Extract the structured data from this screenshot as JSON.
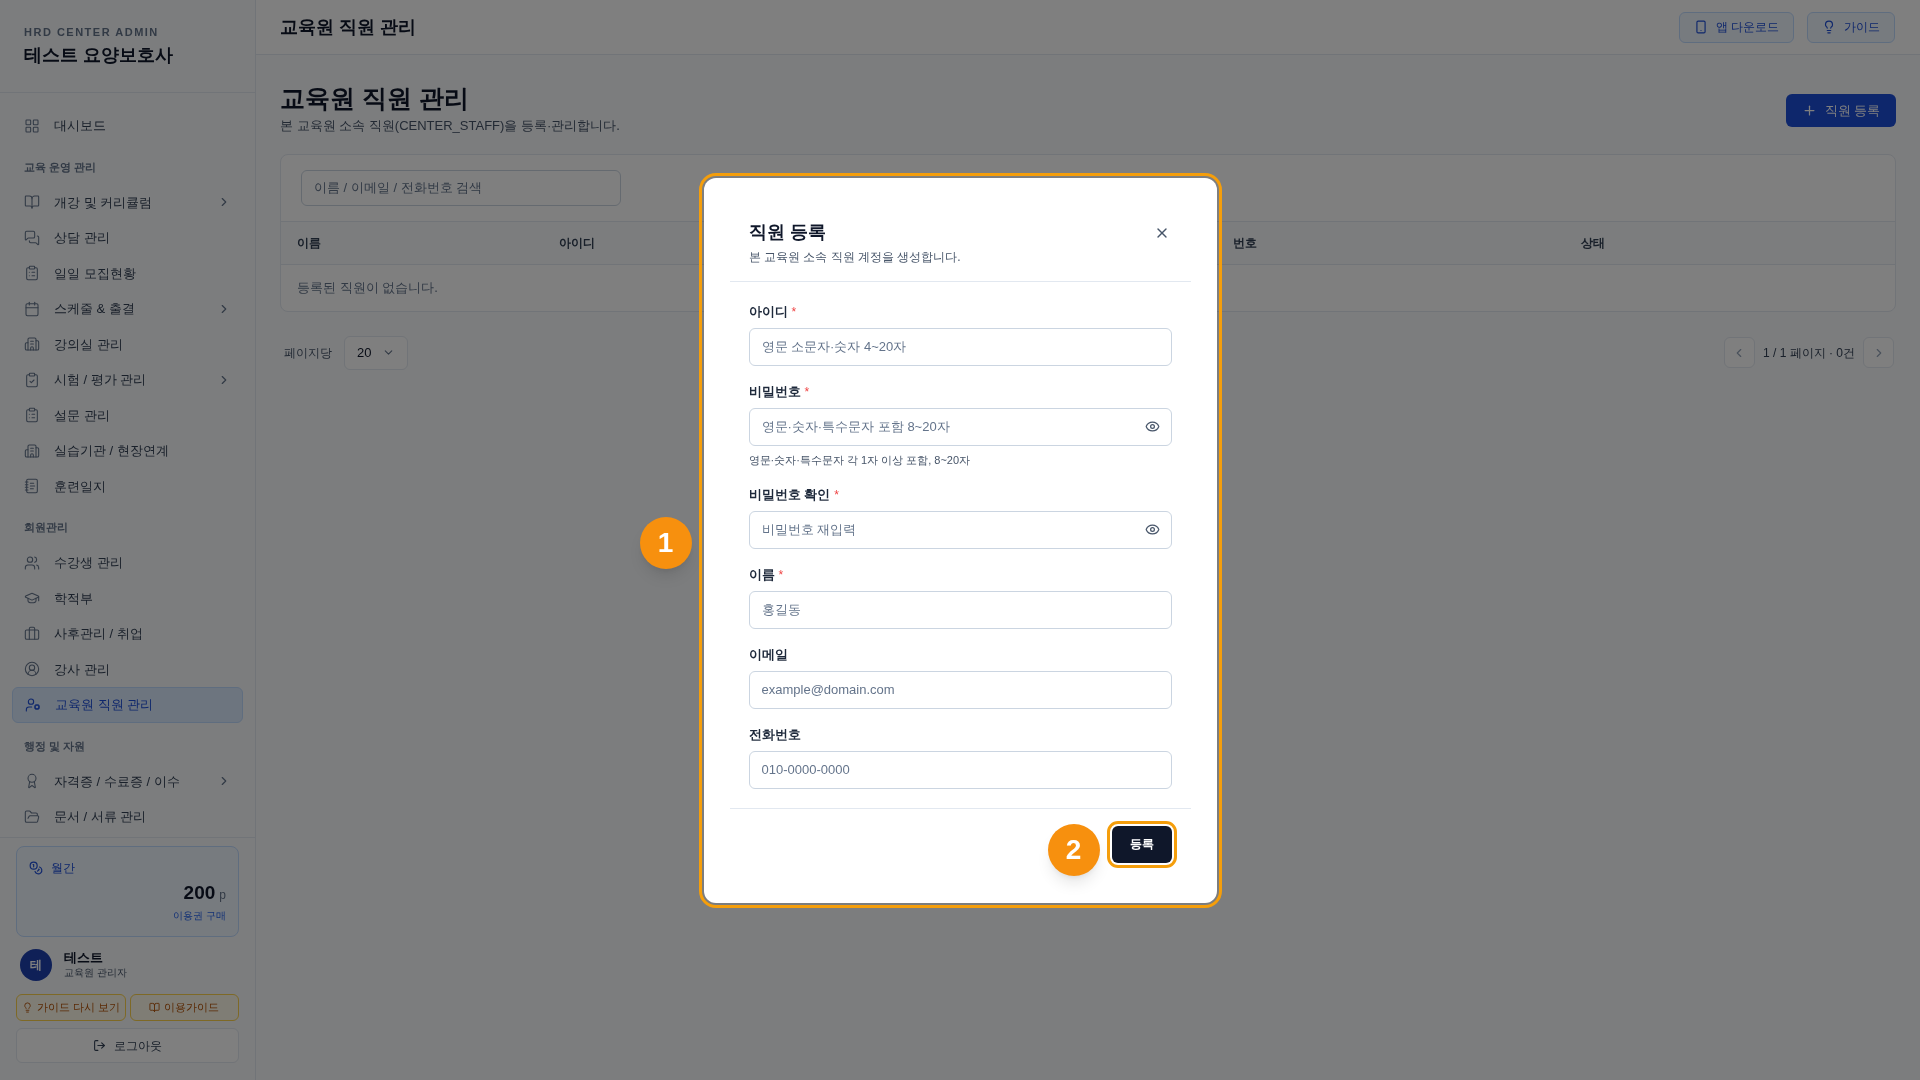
{
  "sidebar": {
    "brand": "HRD CENTER ADMIN",
    "title": "테스트 요양보호사",
    "sections": [
      {
        "items": [
          {
            "label": "대시보드",
            "expandable": false,
            "selected": false
          }
        ]
      },
      {
        "heading": "교육 운영 관리",
        "items": [
          {
            "label": "개강 및 커리큘럼",
            "expandable": true,
            "selected": false
          },
          {
            "label": "상담 관리",
            "expandable": false,
            "selected": false
          },
          {
            "label": "일일 모집현황",
            "expandable": false,
            "selected": false
          },
          {
            "label": "스케줄 & 출결",
            "expandable": true,
            "selected": false
          },
          {
            "label": "강의실 관리",
            "expandable": false,
            "selected": false
          },
          {
            "label": "시험 / 평가 관리",
            "expandable": true,
            "selected": false
          },
          {
            "label": "설문 관리",
            "expandable": false,
            "selected": false
          },
          {
            "label": "실습기관 / 현장연계",
            "expandable": false,
            "selected": false
          },
          {
            "label": "훈련일지",
            "expandable": false,
            "selected": false
          }
        ]
      },
      {
        "heading": "회원관리",
        "items": [
          {
            "label": "수강생 관리",
            "expandable": false,
            "selected": false
          },
          {
            "label": "학적부",
            "expandable": false,
            "selected": false
          },
          {
            "label": "사후관리 / 취업",
            "expandable": false,
            "selected": false
          },
          {
            "label": "강사 관리",
            "expandable": false,
            "selected": false
          },
          {
            "label": "교육원 직원 관리",
            "expandable": false,
            "selected": true
          }
        ]
      },
      {
        "heading": "행정 및 자원",
        "items": [
          {
            "label": "자격증 / 수료증 / 이수",
            "expandable": true,
            "selected": false
          },
          {
            "label": "문서 / 서류 관리",
            "expandable": false,
            "selected": false
          }
        ]
      }
    ],
    "credit": {
      "label": "월간",
      "amount": "200",
      "unit": "p",
      "link": "이용권 구매"
    },
    "user": {
      "initial": "테",
      "name": "테스트",
      "role": "교육원 관리자"
    },
    "guide_buttons": [
      "가이드 다시 보기",
      "이용가이드"
    ],
    "logout": "로그아웃"
  },
  "header": {
    "title": "교육원 직원 관리",
    "buttons": [
      "앱 다운로드",
      "가이드"
    ]
  },
  "page": {
    "title": "교육원 직원 관리",
    "subtitle": "본 교육원 소속 직원(CENTER_STAFF)을 등록·관리합니다.",
    "add_button": "직원 등록"
  },
  "table": {
    "search_placeholder": "이름 / 이메일 / 전화번호 검색",
    "columns": [
      "이름",
      "아이디",
      "번호",
      "상태"
    ],
    "empty": "등록된 직원이 없습니다."
  },
  "pagination": {
    "per_page_label": "페이지당",
    "per_page": "20",
    "summary": "1 / 1 페이지 · 0건"
  },
  "dialog": {
    "title": "직원 등록",
    "description": "본 교육원 소속 직원 계정을 생성합니다.",
    "submit": "등록",
    "fields": [
      {
        "label": "아이디",
        "required_mark": "*",
        "kind": "text",
        "placeholder": "영문 소문자·숫자 4~20자"
      },
      {
        "label": "비밀번호",
        "required_mark": "*",
        "kind": "password",
        "placeholder": "영문·숫자·특수문자 포함 8~20자",
        "hint": "영문·숫자·특수문자 각 1자 이상 포함, 8~20자"
      },
      {
        "label": "비밀번호 확인",
        "required_mark": "*",
        "kind": "password",
        "placeholder": "비밀번호 재입력"
      },
      {
        "label": "이름",
        "required_mark": "*",
        "kind": "text",
        "placeholder": "홍길동"
      },
      {
        "label": "이메일",
        "kind": "text",
        "placeholder": "example@domain.com"
      },
      {
        "label": "전화번호",
        "kind": "text",
        "placeholder": "010-0000-0000"
      }
    ]
  },
  "annotations": [
    "1",
    "2"
  ]
}
